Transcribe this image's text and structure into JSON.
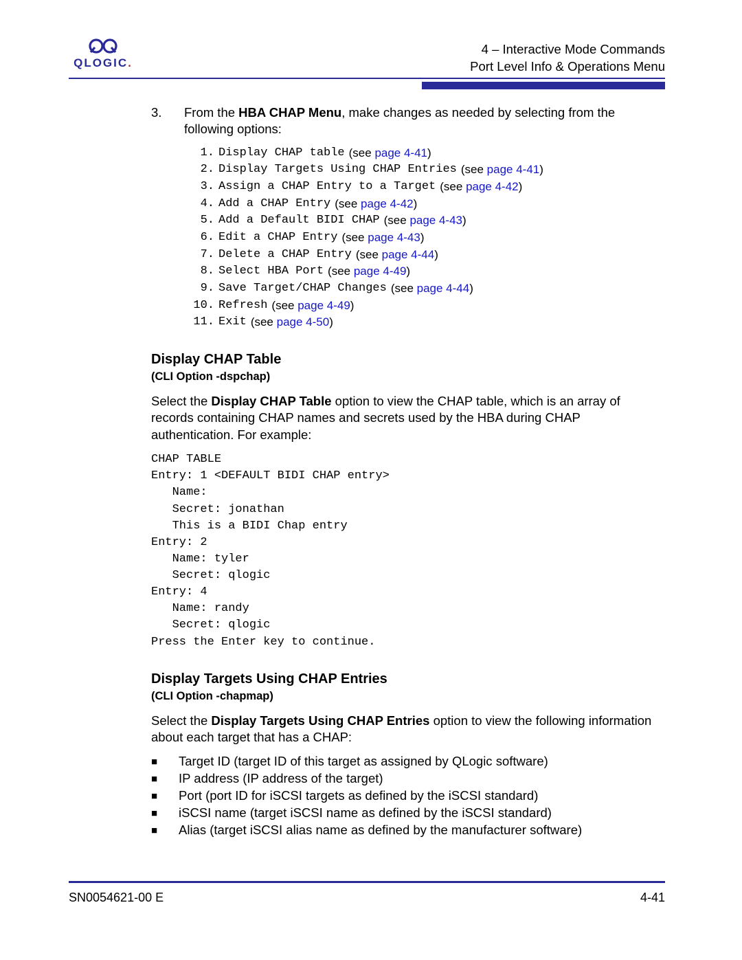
{
  "logo_text": "QLOGIC",
  "header": {
    "line1": "4 – Interactive Mode Commands",
    "line2": "Port Level Info & Operations Menu"
  },
  "step3": {
    "num": "3.",
    "pre": "From the ",
    "bold": "HBA CHAP Menu",
    "post": ", make changes as needed by selecting from the following options:"
  },
  "menu": [
    {
      "n": " 1.",
      "label": "Display CHAP table",
      "see": " (see ",
      "page": "page 4-41",
      "end": ")"
    },
    {
      "n": " 2.",
      "label": "Display Targets Using CHAP Entries",
      "see": " (see ",
      "page": "page 4-41",
      "end": ")"
    },
    {
      "n": " 3.",
      "label": "Assign a CHAP Entry to a Target",
      "see": " (see ",
      "page": "page 4-42",
      "end": ")"
    },
    {
      "n": " 4.",
      "label": "Add a CHAP Entry",
      "see": " (see ",
      "page": "page 4-42",
      "end": ")"
    },
    {
      "n": " 5.",
      "label": "Add a Default BIDI CHAP",
      "see": " (see ",
      "page": "page 4-43",
      "end": ")"
    },
    {
      "n": " 6.",
      "label": "Edit a CHAP Entry",
      "see": " (see ",
      "page": "page 4-43",
      "end": ")"
    },
    {
      "n": " 7.",
      "label": "Delete a CHAP Entry",
      "see": " (see ",
      "page": "page 4-44",
      "end": ")"
    },
    {
      "n": " 8.",
      "label": "Select HBA Port",
      "see": " (see ",
      "page": "page 4-49",
      "end": ")"
    },
    {
      "n": " 9.",
      "label": "Save Target/CHAP Changes",
      "see": " (see ",
      "page": "page 4-44",
      "end": ")"
    },
    {
      "n": "10.",
      "label": "Refresh",
      "see": " (see ",
      "page": "page 4-49",
      "end": ")"
    },
    {
      "n": "11.",
      "label": "Exit",
      "see": " (see ",
      "page": "page 4-50",
      "end": ")"
    }
  ],
  "sec1": {
    "title": "Display CHAP Table",
    "sub": "(CLI Option -dspchap)",
    "p_pre": "Select the ",
    "p_bold": "Display CHAP Table",
    "p_post": " option to view the CHAP table, which is an array of records containing CHAP names and secrets used by the HBA during CHAP authentication. For example:",
    "code": "CHAP TABLE\nEntry: 1 <DEFAULT BIDI CHAP entry>\n   Name:\n   Secret: jonathan\n   This is a BIDI Chap entry\nEntry: 2\n   Name: tyler\n   Secret: qlogic\nEntry: 4\n   Name: randy\n   Secret: qlogic\nPress the Enter key to continue."
  },
  "sec2": {
    "title": "Display Targets Using CHAP Entries",
    "sub": "(CLI Option -chapmap)",
    "p_pre": "Select the ",
    "p_bold": "Display Targets Using CHAP Entries",
    "p_post": " option to view the following information about each target that has a CHAP:",
    "bullets": [
      "Target ID (target ID of this target as assigned by QLogic software)",
      "IP address (IP address of the target)",
      "Port (port ID for iSCSI targets as defined by the iSCSI standard)",
      "iSCSI name (target iSCSI name as defined by the iSCSI standard)",
      "Alias (target iSCSI alias name as defined by the manufacturer software)"
    ]
  },
  "footer": {
    "left": "SN0054621-00 E",
    "right": "4-41"
  }
}
